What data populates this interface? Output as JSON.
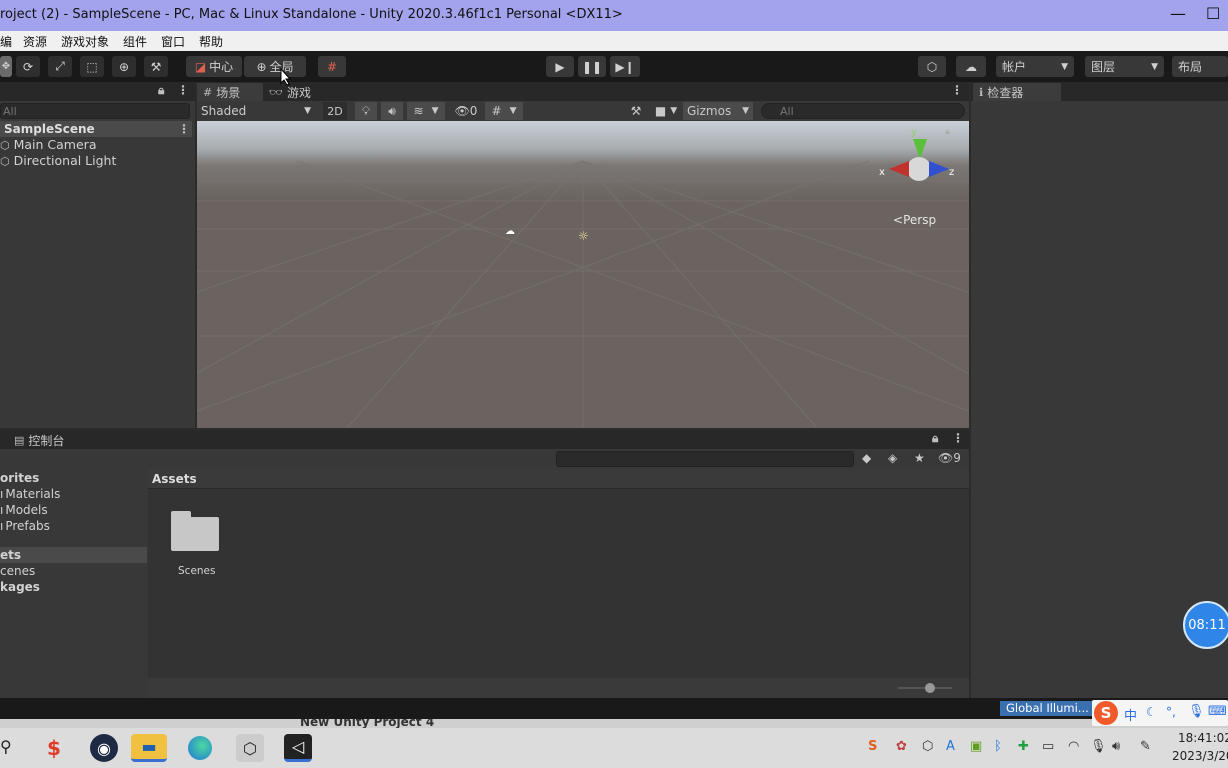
{
  "window": {
    "title": "roject (2) - SampleScene - PC, Mac & Linux Standalone - Unity 2020.3.46f1c1 Personal <DX11>",
    "minimize": "—",
    "maximize": "☐"
  },
  "menu": [
    "编",
    "资源",
    "游戏对象",
    "组件",
    "窗口",
    "帮助"
  ],
  "toolbar": {
    "pivot_label": "中心",
    "global_label": "全局",
    "account_label": "帐户",
    "layers_label": "图层",
    "layout_label": "布局"
  },
  "hierarchy": {
    "search_placeholder": "All",
    "scene_name": "SampleScene",
    "items": [
      "Main Camera",
      "Directional Light"
    ]
  },
  "scene_view": {
    "tabs": [
      {
        "label": "场景",
        "icon": "grid-icon"
      },
      {
        "label": "游戏",
        "icon": "gamepad-icon"
      }
    ],
    "shading_mode": "Shaded",
    "mode_2d": "2D",
    "hidden_count": "0",
    "gizmos_label": "Gizmos",
    "search_placeholder": "All",
    "persp_label": "Persp",
    "axis_x": "x",
    "axis_y": "y",
    "axis_z": "z"
  },
  "inspector": {
    "tab_label": "检查器"
  },
  "console": {
    "tab_label": "控制台"
  },
  "project": {
    "favorites_label": "orites",
    "favorites": [
      "Materials",
      "Models",
      "Prefabs"
    ],
    "assets_label": "ets",
    "assets_children": [
      "cenes"
    ],
    "packages_label": "kages",
    "breadcrumb": "Assets",
    "folders": [
      "Scenes"
    ],
    "hidden_count": "9"
  },
  "statusbar": {
    "global_illum": "Global Illumi...",
    "behind_window_text": "New Unity Project 4"
  },
  "timer_badge": "08:11",
  "ime": {
    "lang": "中"
  },
  "taskbar": {
    "time": "18:41:02",
    "date": "2023/3/20"
  },
  "colors": {
    "titlebar": "#a3a3ed",
    "toolbar": "#191919",
    "panel": "#383838",
    "scene_ground": "#6a635f",
    "timer_badge": "#2f86e8"
  }
}
